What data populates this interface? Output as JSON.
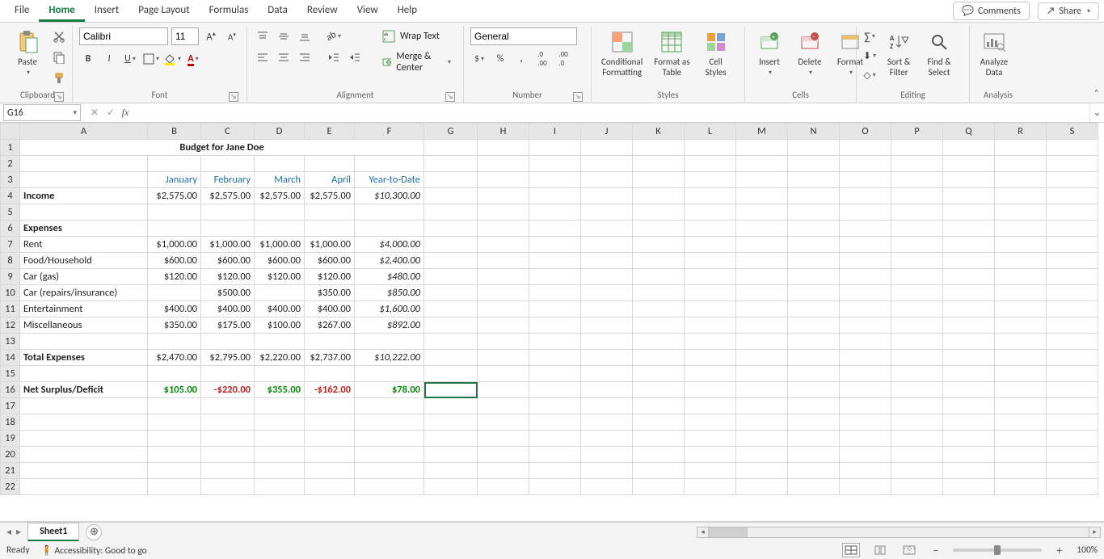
{
  "menu": {
    "tabs": [
      "File",
      "Home",
      "Insert",
      "Page Layout",
      "Formulas",
      "Data",
      "Review",
      "View",
      "Help"
    ],
    "active": "Home",
    "comments": "Comments",
    "share": "Share"
  },
  "ribbon": {
    "clipboard": {
      "paste": "Paste",
      "label": "Clipboard"
    },
    "font": {
      "name": "Calibri",
      "size": "11",
      "label": "Font"
    },
    "alignment": {
      "wrap": "Wrap Text",
      "merge": "Merge & Center",
      "label": "Alignment"
    },
    "number": {
      "format": "General",
      "label": "Number"
    },
    "styles": {
      "cond": "Conditional\nFormatting",
      "fat": "Format as\nTable",
      "cell": "Cell\nStyles",
      "label": "Styles"
    },
    "cells": {
      "insert": "Insert",
      "delete": "Delete",
      "format": "Format",
      "label": "Cells"
    },
    "editing": {
      "sort": "Sort &\nFilter",
      "find": "Find &\nSelect",
      "label": "Editing"
    },
    "analysis": {
      "analyze": "Analyze\nData",
      "label": "Analysis"
    }
  },
  "fx": {
    "namebox": "G16",
    "formula": ""
  },
  "columns": [
    "A",
    "B",
    "C",
    "D",
    "E",
    "F",
    "G",
    "H",
    "I",
    "J",
    "K",
    "L",
    "M",
    "N",
    "O",
    "P",
    "Q",
    "R",
    "S"
  ],
  "selected": {
    "row": 16,
    "col": "G"
  },
  "sheet": {
    "title": "Budget for Jane Doe",
    "months": [
      "January",
      "February",
      "March",
      "April",
      "Year-to-Date"
    ],
    "rows": [
      {
        "r": 4,
        "label": "Income",
        "bold": true,
        "vals": [
          "$2,575.00",
          "$2,575.00",
          "$2,575.00",
          "$2,575.00"
        ],
        "ytd": "$10,300.00"
      },
      {
        "r": 5,
        "label": "",
        "vals": [
          "",
          "",
          "",
          ""
        ],
        "ytd": ""
      },
      {
        "r": 6,
        "label": "Expenses",
        "bold": true,
        "vals": [
          "",
          "",
          "",
          ""
        ],
        "ytd": ""
      },
      {
        "r": 7,
        "label": "Rent",
        "vals": [
          "$1,000.00",
          "$1,000.00",
          "$1,000.00",
          "$1,000.00"
        ],
        "ytd": "$4,000.00"
      },
      {
        "r": 8,
        "label": "Food/Household",
        "vals": [
          "$600.00",
          "$600.00",
          "$600.00",
          "$600.00"
        ],
        "ytd": "$2,400.00"
      },
      {
        "r": 9,
        "label": "Car (gas)",
        "vals": [
          "$120.00",
          "$120.00",
          "$120.00",
          "$120.00"
        ],
        "ytd": "$480.00"
      },
      {
        "r": 10,
        "label": "Car (repairs/insurance)",
        "vals": [
          "",
          "$500.00",
          "",
          "$350.00"
        ],
        "ytd": "$850.00"
      },
      {
        "r": 11,
        "label": "Entertainment",
        "vals": [
          "$400.00",
          "$400.00",
          "$400.00",
          "$400.00"
        ],
        "ytd": "$1,600.00"
      },
      {
        "r": 12,
        "label": "Miscellaneous",
        "vals": [
          "$350.00",
          "$175.00",
          "$100.00",
          "$267.00"
        ],
        "ytd": "$892.00"
      },
      {
        "r": 13,
        "label": "",
        "vals": [
          "",
          "",
          "",
          ""
        ],
        "ytd": ""
      },
      {
        "r": 14,
        "label": "Total Expenses",
        "bold": true,
        "vals": [
          "$2,470.00",
          "$2,795.00",
          "$2,220.00",
          "$2,737.00"
        ],
        "ytd": "$10,222.00"
      },
      {
        "r": 15,
        "label": "",
        "vals": [
          "",
          "",
          "",
          ""
        ],
        "ytd": ""
      },
      {
        "r": 16,
        "label": "Net Surplus/Deficit",
        "bold": true,
        "net": true,
        "vals": [
          "$105.00",
          "-$220.00",
          "$355.00",
          "-$162.00"
        ],
        "ytd": "$78.00",
        "signs": [
          "pos",
          "neg",
          "pos",
          "neg",
          "pos"
        ]
      }
    ]
  },
  "tabs": {
    "sheet": "Sheet1"
  },
  "status": {
    "ready": "Ready",
    "access": "Accessibility: Good to go",
    "zoom": "100%"
  }
}
